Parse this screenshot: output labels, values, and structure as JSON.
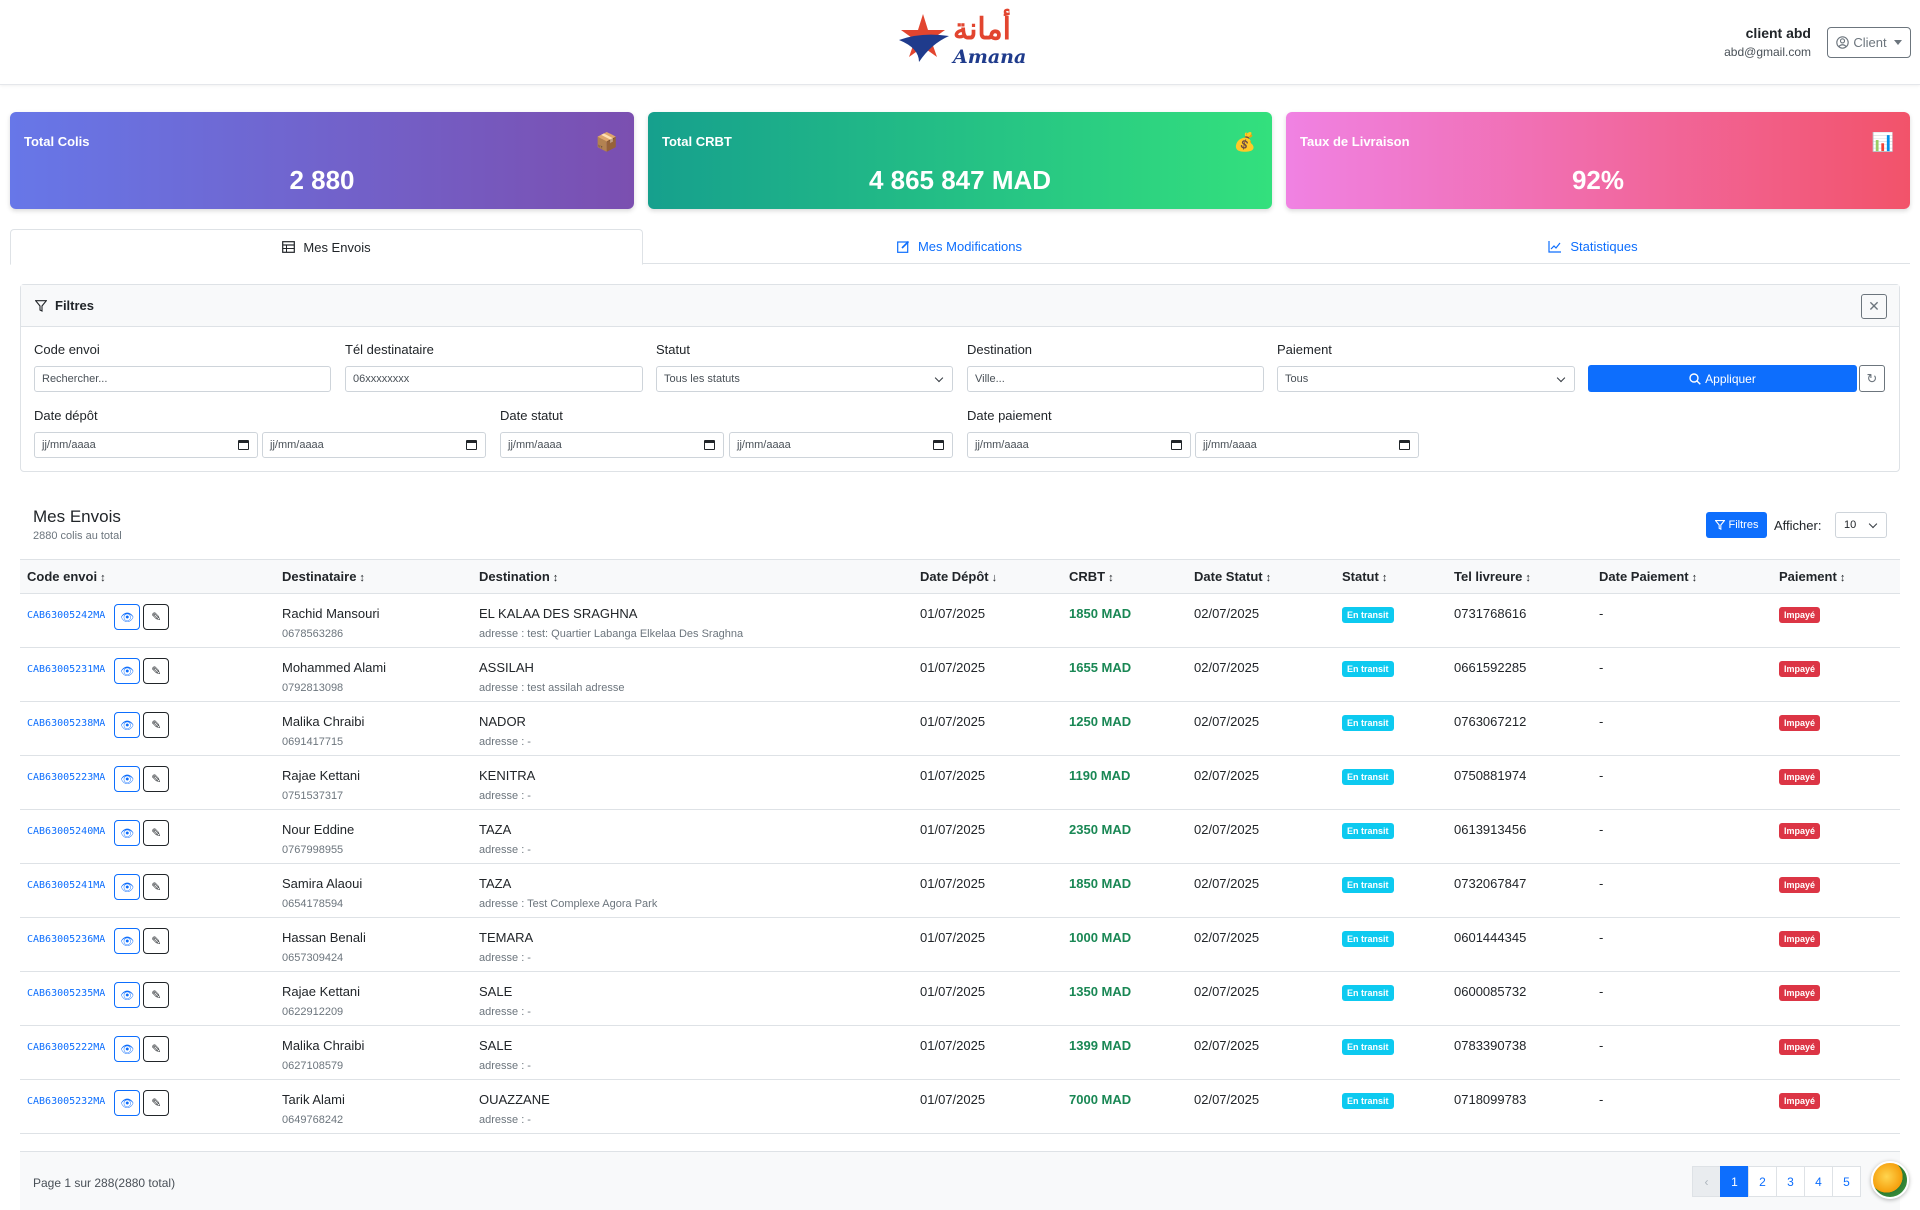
{
  "header": {
    "logo_arabic": "أمانة",
    "logo_latin": "Amana",
    "user_name": "client abd",
    "user_email": "abd@gmail.com",
    "role_button": "Client"
  },
  "stats": [
    {
      "title": "Total Colis",
      "value": "2 880",
      "icon": "package-icon"
    },
    {
      "title": "Total CRBT",
      "value": "4 865 847 MAD",
      "icon": "money-bag-icon"
    },
    {
      "title": "Taux de Livraison",
      "value": "92%",
      "icon": "bar-chart-icon"
    }
  ],
  "tabs": [
    {
      "label": "Mes Envois",
      "active": true
    },
    {
      "label": "Mes Modifications",
      "active": false
    },
    {
      "label": "Statistiques",
      "active": false
    }
  ],
  "filters": {
    "title": "Filtres",
    "code_label": "Code envoi",
    "code_placeholder": "Rechercher...",
    "tel_label": "Tél destinataire",
    "tel_placeholder": "06xxxxxxxx",
    "statut_label": "Statut",
    "statut_value": "Tous les statuts",
    "destination_label": "Destination",
    "destination_placeholder": "Ville...",
    "paiement_label": "Paiement",
    "paiement_value": "Tous",
    "apply_label": "Appliquer",
    "date_depot_label": "Date dépôt",
    "date_statut_label": "Date statut",
    "date_paiement_label": "Date paiement",
    "date_placeholder": "jj/mm/aaaa"
  },
  "list": {
    "title": "Mes Envois",
    "subtitle": "2880 colis au total",
    "filtres_button": "Filtres",
    "afficher_label": "Afficher:",
    "afficher_value": "10",
    "columns": [
      "Code envoi",
      "Destinataire",
      "Destination",
      "Date Dépôt",
      "CRBT",
      "Date Statut",
      "Statut",
      "Tel livreure",
      "Date Paiement",
      "Paiement"
    ],
    "rows": [
      {
        "code": "CAB63005242MA",
        "name": "Rachid Mansouri",
        "phone": "0678563286",
        "city": "EL KALAA DES SRAGHNA",
        "address": "adresse : test: Quartier Labanga Elkelaa Des Sraghna",
        "date_depot": "01/07/2025",
        "crbt": "1850 MAD",
        "date_statut": "02/07/2025",
        "statut": "En transit",
        "tel_livreur": "0731768616",
        "date_paiement": "-",
        "paiement": "Impayé"
      },
      {
        "code": "CAB63005231MA",
        "name": "Mohammed Alami",
        "phone": "0792813098",
        "city": "ASSILAH",
        "address": "adresse : test assilah adresse",
        "date_depot": "01/07/2025",
        "crbt": "1655 MAD",
        "date_statut": "02/07/2025",
        "statut": "En transit",
        "tel_livreur": "0661592285",
        "date_paiement": "-",
        "paiement": "Impayé"
      },
      {
        "code": "CAB63005238MA",
        "name": "Malika Chraibi",
        "phone": "0691417715",
        "city": "NADOR",
        "address": "adresse : -",
        "date_depot": "01/07/2025",
        "crbt": "1250 MAD",
        "date_statut": "02/07/2025",
        "statut": "En transit",
        "tel_livreur": "0763067212",
        "date_paiement": "-",
        "paiement": "Impayé"
      },
      {
        "code": "CAB63005223MA",
        "name": "Rajae Kettani",
        "phone": "0751537317",
        "city": "KENITRA",
        "address": "adresse : -",
        "date_depot": "01/07/2025",
        "crbt": "1190 MAD",
        "date_statut": "02/07/2025",
        "statut": "En transit",
        "tel_livreur": "0750881974",
        "date_paiement": "-",
        "paiement": "Impayé"
      },
      {
        "code": "CAB63005240MA",
        "name": "Nour Eddine",
        "phone": "0767998955",
        "city": "TAZA",
        "address": "adresse : -",
        "date_depot": "01/07/2025",
        "crbt": "2350 MAD",
        "date_statut": "02/07/2025",
        "statut": "En transit",
        "tel_livreur": "0613913456",
        "date_paiement": "-",
        "paiement": "Impayé"
      },
      {
        "code": "CAB63005241MA",
        "name": "Samira Alaoui",
        "phone": "0654178594",
        "city": "TAZA",
        "address": "adresse : Test Complexe Agora Park",
        "date_depot": "01/07/2025",
        "crbt": "1850 MAD",
        "date_statut": "02/07/2025",
        "statut": "En transit",
        "tel_livreur": "0732067847",
        "date_paiement": "-",
        "paiement": "Impayé"
      },
      {
        "code": "CAB63005236MA",
        "name": "Hassan Benali",
        "phone": "0657309424",
        "city": "TEMARA",
        "address": "adresse : -",
        "date_depot": "01/07/2025",
        "crbt": "1000 MAD",
        "date_statut": "02/07/2025",
        "statut": "En transit",
        "tel_livreur": "0601444345",
        "date_paiement": "-",
        "paiement": "Impayé"
      },
      {
        "code": "CAB63005235MA",
        "name": "Rajae Kettani",
        "phone": "0622912209",
        "city": "SALE",
        "address": "adresse : -",
        "date_depot": "01/07/2025",
        "crbt": "1350 MAD",
        "date_statut": "02/07/2025",
        "statut": "En transit",
        "tel_livreur": "0600085732",
        "date_paiement": "-",
        "paiement": "Impayé"
      },
      {
        "code": "CAB63005222MA",
        "name": "Malika Chraibi",
        "phone": "0627108579",
        "city": "SALE",
        "address": "adresse : -",
        "date_depot": "01/07/2025",
        "crbt": "1399 MAD",
        "date_statut": "02/07/2025",
        "statut": "En transit",
        "tel_livreur": "0783390738",
        "date_paiement": "-",
        "paiement": "Impayé"
      },
      {
        "code": "CAB63005232MA",
        "name": "Tarik Alami",
        "phone": "0649768242",
        "city": "OUAZZANE",
        "address": "adresse : -",
        "date_depot": "01/07/2025",
        "crbt": "7000 MAD",
        "date_statut": "02/07/2025",
        "statut": "En transit",
        "tel_livreur": "0718099783",
        "date_paiement": "-",
        "paiement": "Impayé"
      }
    ]
  },
  "footer": {
    "page_info": "Page 1 sur 288(2880 total)",
    "prev": "‹",
    "pages": [
      "1",
      "2",
      "3",
      "4",
      "5"
    ]
  },
  "colors": {
    "primary": "#0d6efd",
    "success": "#198754",
    "info": "#0dcaf0",
    "danger": "#dc3545"
  }
}
